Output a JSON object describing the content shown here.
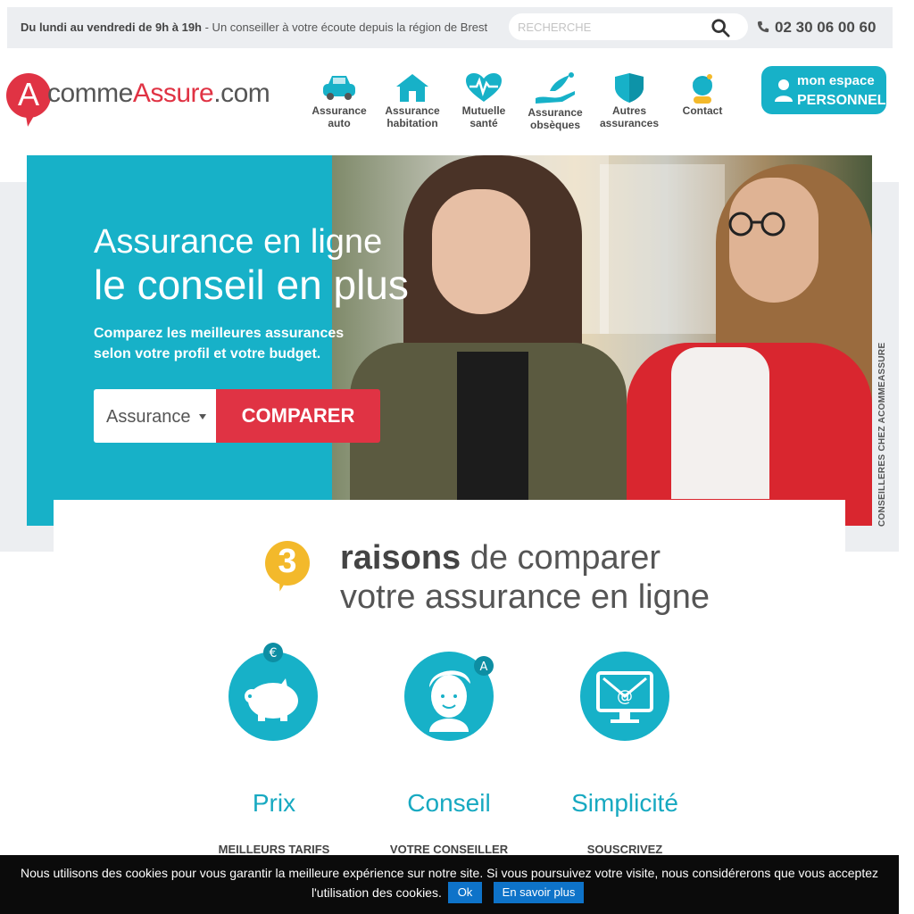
{
  "topbar": {
    "hours_bold": "Du lundi au vendredi de 9h à 19h",
    "hours_rest": " - Un conseiller à votre écoute depuis la région de Brest",
    "search_placeholder": "RECHERCHE",
    "phone": "02 30 06 00 60"
  },
  "logo": {
    "letter": "A",
    "part1": "comme",
    "part2": "Assure",
    "part3": ".com"
  },
  "nav": [
    {
      "line1": "Assurance",
      "line2": "auto",
      "icon": "car-icon"
    },
    {
      "line1": "Assurance",
      "line2": "habitation",
      "icon": "house-icon"
    },
    {
      "line1": "Mutuelle",
      "line2": "santé",
      "icon": "heart-pulse-icon"
    },
    {
      "line1": "Assurance",
      "line2": "obsèques",
      "icon": "dove-hand-icon"
    },
    {
      "line1": "Autres",
      "line2": "assurances",
      "icon": "shield-icon"
    },
    {
      "line1": "Contact",
      "line2": "",
      "icon": "advisor-icon"
    }
  ],
  "espace": {
    "line1": "mon espace",
    "line2": "PERSONNEL"
  },
  "hero": {
    "title1": "Assurance en ligne",
    "title2": "le conseil en plus",
    "subtitle": "Comparez les meilleures assurances selon votre profil et votre budget.",
    "select_value": "Assurance",
    "cta": "COMPARER",
    "side_text": "CONSEILLERES CHEZ ACOMMEASSURE"
  },
  "reasons": {
    "number": "3",
    "bold": "raisons",
    "rest1": " de comparer",
    "line2": "votre assurance en ligne",
    "items": [
      {
        "title": "Prix",
        "caption": "MEILLEURS TARIFS",
        "icon": "piggy-bank-icon"
      },
      {
        "title": "Conseil",
        "caption": "VOTRE CONSEILLER",
        "icon": "advisor-face-icon"
      },
      {
        "title": "Simplicité",
        "caption": "SOUSCRIVEZ",
        "icon": "computer-email-icon"
      }
    ]
  },
  "cookie": {
    "line1": "Nous utilisons des cookies pour vous garantir la meilleure expérience sur notre site. Si vous poursuivez votre visite, nous considérerons que vous acceptez",
    "line2": "l'utilisation des cookies.",
    "ok": "Ok",
    "more": "En savoir plus"
  },
  "colors": {
    "brand_red": "#e03344",
    "brand_cyan": "#17b1c8",
    "yellow": "#f3b92b"
  }
}
